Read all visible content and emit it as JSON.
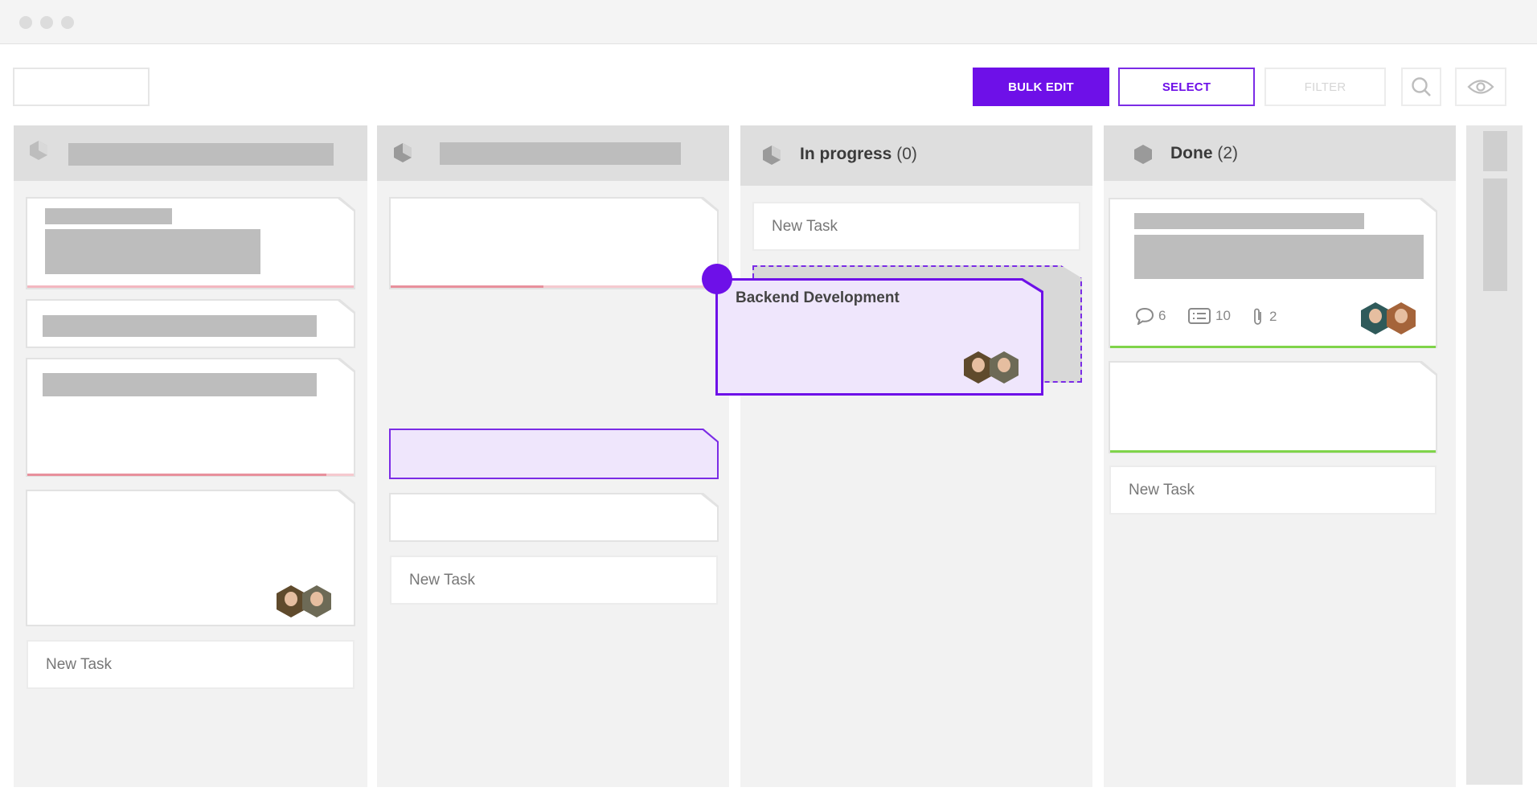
{
  "toolbar": {
    "bulk_edit_label": "BULK EDIT",
    "select_label": "SELECT",
    "filter_label": "FILTER",
    "search_icon": "search-icon",
    "visibility_icon": "eye-icon"
  },
  "columns": [
    {
      "title": "",
      "count": ""
    },
    {
      "title": "",
      "count": ""
    },
    {
      "title": "In progress",
      "count": "(0)"
    },
    {
      "title": "Done",
      "count": "(2)"
    }
  ],
  "in_progress": {
    "new_task_label": "New Task",
    "dragged_card": {
      "title": "Backend Development"
    }
  },
  "done": {
    "card": {
      "comments": "6",
      "checklist": "10",
      "attachments": "2"
    },
    "new_task_label": "New Task"
  },
  "col1": {
    "new_task_label": "New Task"
  },
  "col2": {
    "new_task_label": "New Task"
  },
  "colors": {
    "accent": "#6e10e8",
    "priority_red": "#e8909c",
    "done_green": "#7fd44a"
  }
}
